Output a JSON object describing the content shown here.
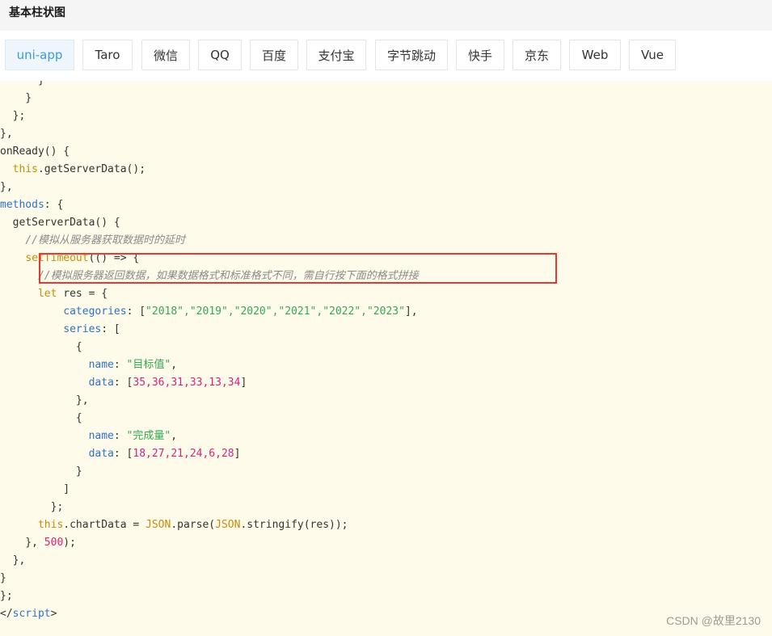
{
  "title": "基本柱状图",
  "tabs": [
    {
      "label": "uni-app",
      "active": true
    },
    {
      "label": "Taro"
    },
    {
      "label": "微信"
    },
    {
      "label": "QQ"
    },
    {
      "label": "百度"
    },
    {
      "label": "支付宝"
    },
    {
      "label": "字节跳动"
    },
    {
      "label": "快手"
    },
    {
      "label": "京东"
    },
    {
      "label": "Web"
    },
    {
      "label": "Vue"
    }
  ],
  "code": {
    "comment1": "//模拟从服务器获取数据时的延时",
    "comment2": "//模拟服务器返回数据，如果数据格式和标准格式不同，需自行按下面的格式拼接",
    "categories": [
      "2018",
      "2019",
      "2020",
      "2021",
      "2022",
      "2023"
    ],
    "series": [
      {
        "name": "目标值",
        "data": [
          35,
          36,
          31,
          33,
          13,
          34
        ]
      },
      {
        "name": "完成量",
        "data": [
          18,
          27,
          21,
          24,
          6,
          28
        ]
      }
    ],
    "delay": 500
  },
  "watermark": "CSDN @故里2130",
  "colors": {
    "highlight_border": "#e53935",
    "active_tab_text": "#3a9bdc",
    "code_bg": "#fefbea"
  }
}
